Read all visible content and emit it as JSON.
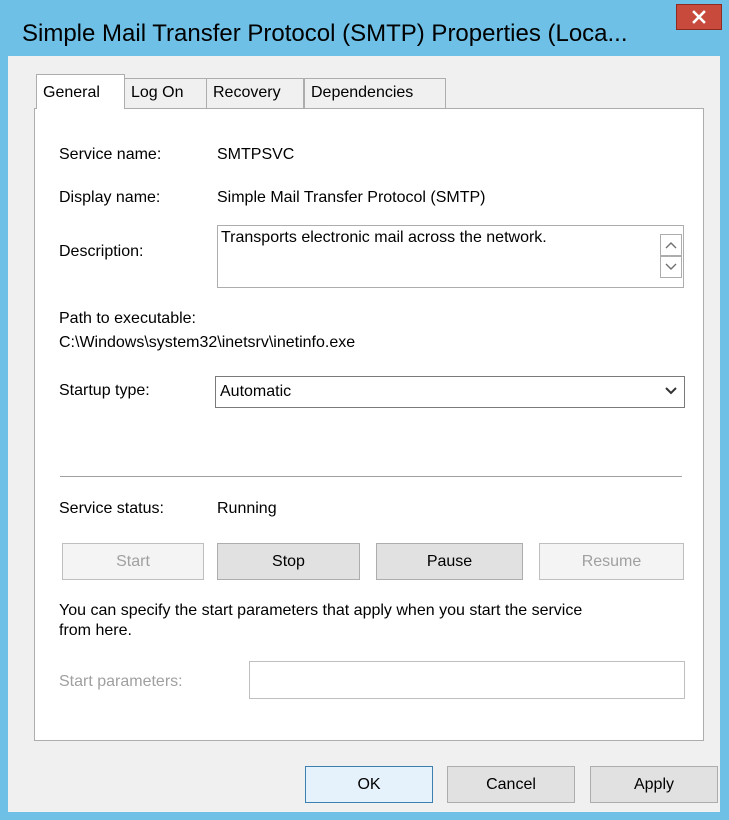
{
  "window": {
    "title": "Simple Mail Transfer Protocol (SMTP) Properties (Loca...",
    "close_label": "x"
  },
  "tabs": [
    {
      "label": "General",
      "active": true
    },
    {
      "label": "Log On",
      "active": false
    },
    {
      "label": "Recovery",
      "active": false
    },
    {
      "label": "Dependencies",
      "active": false
    }
  ],
  "general": {
    "service_name_label": "Service name:",
    "service_name_value": "SMTPSVC",
    "display_name_label": "Display name:",
    "display_name_value": "Simple Mail Transfer Protocol (SMTP)",
    "description_label": "Description:",
    "description_value": "Transports electronic mail across the network.",
    "path_label": "Path to executable:",
    "path_value": "C:\\Windows\\system32\\inetsrv\\inetinfo.exe",
    "startup_type_label": "Startup type:",
    "startup_type_value": "Automatic",
    "service_status_label": "Service status:",
    "service_status_value": "Running",
    "start_label": "Start",
    "stop_label": "Stop",
    "pause_label": "Pause",
    "resume_label": "Resume",
    "hint_text_line1": "You can specify the start parameters that apply when you start the service",
    "hint_text_line2": "from here.",
    "start_params_label": "Start parameters:",
    "start_params_value": ""
  },
  "footer": {
    "ok_label": "OK",
    "cancel_label": "Cancel",
    "apply_label": "Apply"
  },
  "colors": {
    "titlebar": "#6fc0e6",
    "close_button": "#c74a3c",
    "dialog_background": "#f0f0f0",
    "panel_background": "#ffffff",
    "disabled_text": "#a0a0a0"
  }
}
